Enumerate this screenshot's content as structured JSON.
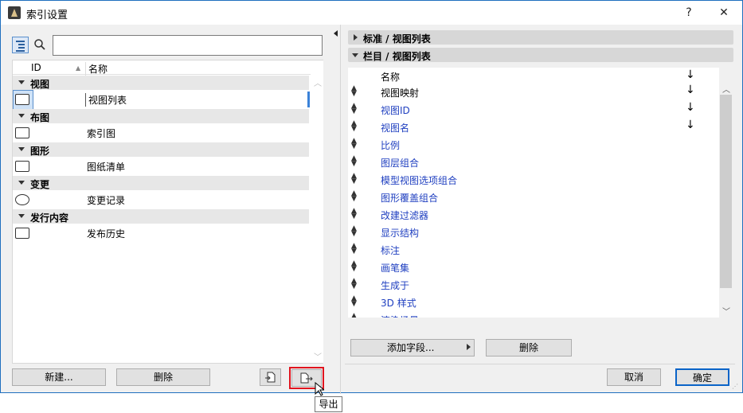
{
  "window": {
    "title": "索引设置",
    "help": "?",
    "close": "✕"
  },
  "left": {
    "search_placeholder": "",
    "columns": {
      "id": "ID",
      "name": "名称"
    },
    "groups": [
      {
        "label": "视图",
        "items": [
          {
            "name": "视图列表",
            "icon": "view-list-icon",
            "selected": true
          }
        ]
      },
      {
        "label": "布图",
        "items": [
          {
            "name": "索引图",
            "icon": "layout-icon"
          }
        ]
      },
      {
        "label": "图形",
        "items": [
          {
            "name": "图纸清单",
            "icon": "drawing-icon"
          }
        ]
      },
      {
        "label": "变更",
        "items": [
          {
            "name": "变更记录",
            "icon": "cloud-icon"
          }
        ]
      },
      {
        "label": "发行内容",
        "items": [
          {
            "name": "发布历史",
            "icon": "publish-icon"
          }
        ]
      }
    ],
    "buttons": {
      "new": "新建...",
      "delete": "删除"
    }
  },
  "tooltip": "导出",
  "right": {
    "bar1": "标准 /  视图列表",
    "bar2": "栏目 /  视图列表",
    "header": {
      "name": "名称",
      "arrow": "↓"
    },
    "rows": [
      {
        "name": "视图映射",
        "arrow": "↓",
        "blue": false
      },
      {
        "name": "视图ID",
        "arrow": "↓",
        "blue": true
      },
      {
        "name": "视图名",
        "arrow": "↓",
        "blue": true
      },
      {
        "name": "比例",
        "arrow": "",
        "blue": true
      },
      {
        "name": "图层组合",
        "arrow": "",
        "blue": true
      },
      {
        "name": "模型视图选项组合",
        "arrow": "",
        "blue": true
      },
      {
        "name": "图形覆盖组合",
        "arrow": "",
        "blue": true
      },
      {
        "name": "改建过滤器",
        "arrow": "",
        "blue": true
      },
      {
        "name": "显示结构",
        "arrow": "",
        "blue": true
      },
      {
        "name": "标注",
        "arrow": "",
        "blue": true
      },
      {
        "name": "画笔集",
        "arrow": "",
        "blue": true
      },
      {
        "name": "生成于",
        "arrow": "",
        "blue": true
      },
      {
        "name": "3D 样式",
        "arrow": "",
        "blue": true
      },
      {
        "name": "渲染场景",
        "arrow": "",
        "blue": true
      }
    ],
    "buttons": {
      "add_field": "添加字段...",
      "delete": "删除",
      "cancel": "取消",
      "ok": "确定"
    }
  }
}
